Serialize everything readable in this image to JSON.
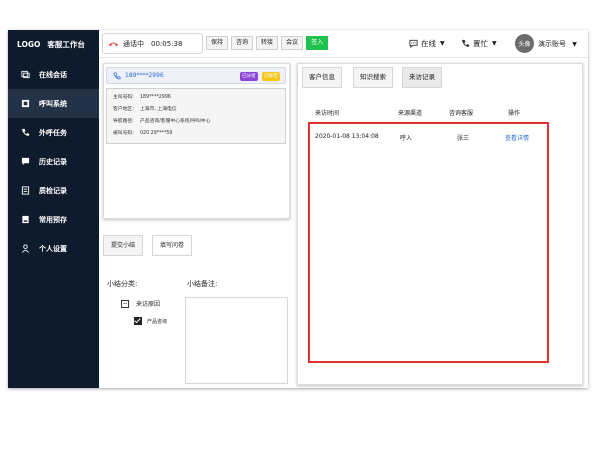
{
  "app": {
    "logo": "LOGO",
    "title": "客服工作台"
  },
  "sidebar": {
    "items": [
      {
        "label": "在线会话",
        "icon": "online-chat-icon"
      },
      {
        "label": "呼叫系统",
        "icon": "phone-system-icon",
        "active": true
      },
      {
        "label": "外呼任务",
        "icon": "outbound-call-icon"
      },
      {
        "label": "历史记录",
        "icon": "history-icon"
      },
      {
        "label": "质检记录",
        "icon": "quality-check-icon"
      },
      {
        "label": "常用预存",
        "icon": "saved-icon"
      },
      {
        "label": "个人设置",
        "icon": "user-icon"
      }
    ]
  },
  "topbar": {
    "call_status": "通话中",
    "call_timer": "00:05:38",
    "buttons": [
      "保持",
      "咨询",
      "转接",
      "会议",
      "签入"
    ],
    "online_status": "在线",
    "busy_status": "置忙",
    "avatar_text": "头像",
    "account": "演示账号"
  },
  "caller": {
    "phone": "189****2996",
    "badges": [
      "已分组",
      "已静音"
    ],
    "info": [
      {
        "key": "主叫号码:",
        "value": "189****2996"
      },
      {
        "key": "客户地区:",
        "value": "上海市, 上海电信"
      },
      {
        "key": "导航路径:",
        "value": "产品咨询/客服中心系统/呼叫中心"
      },
      {
        "key": "被叫号码:",
        "value": "020 29****59"
      }
    ]
  },
  "summary": {
    "tabs": [
      "提交小结",
      "填写问卷"
    ],
    "category_label": "小结分类:",
    "notes_label": "小结备注:",
    "tree_parent": "来访原因",
    "tree_child": "产品咨询",
    "submit_label": "提交"
  },
  "records": {
    "tabs": [
      "客户信息",
      "知识搜索",
      "来访记录"
    ],
    "columns": [
      "来访时间",
      "来源渠道",
      "咨询客服",
      "操作"
    ],
    "rows": [
      {
        "time": "2020-01-08  13:04:08",
        "channel": "呼入",
        "agent": "张三",
        "action": "查看详情"
      }
    ]
  },
  "colors": {
    "sidebar_bg": "#0e1b2c",
    "green": "#1fc24d",
    "highlight_red": "#e42f2f",
    "link": "#2b6fd8"
  }
}
